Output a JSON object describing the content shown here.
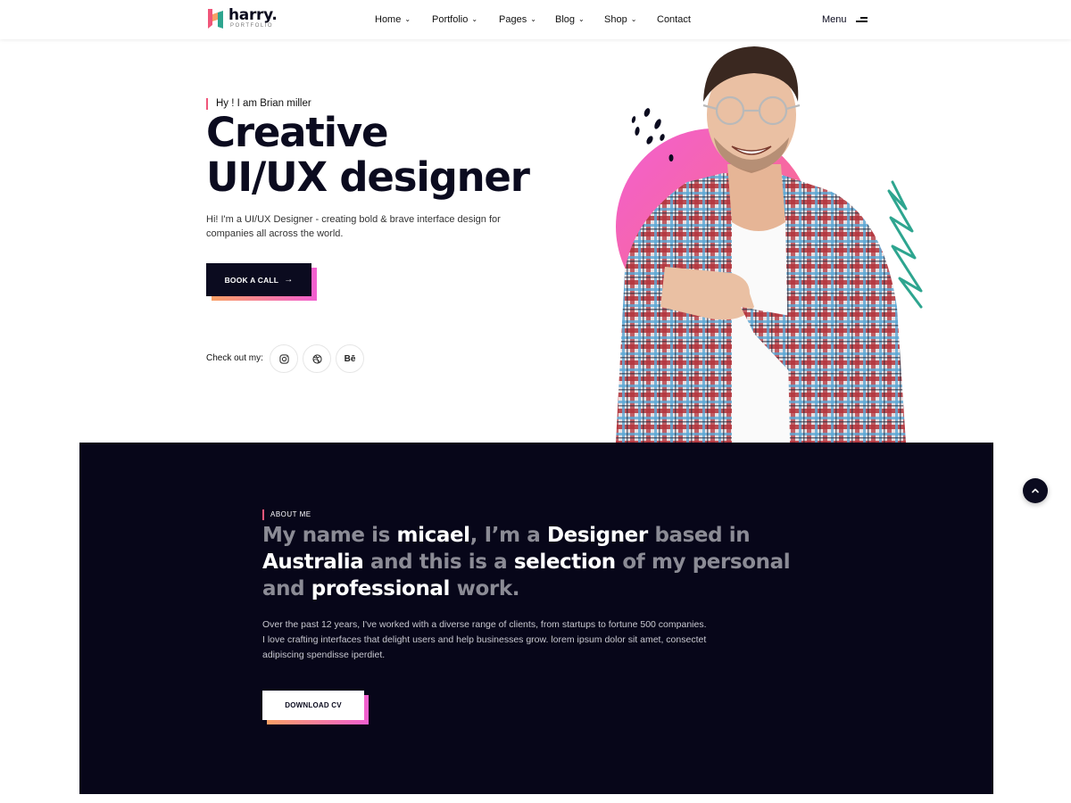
{
  "brand": {
    "name": "harry.",
    "sub": "PORTFOLIO"
  },
  "nav": {
    "items": [
      {
        "label": "Home",
        "dropdown": true
      },
      {
        "label": "Portfolio",
        "dropdown": true
      },
      {
        "label": "Pages",
        "dropdown": true
      },
      {
        "label": "Blog",
        "dropdown": true
      },
      {
        "label": "Shop",
        "dropdown": true
      },
      {
        "label": "Contact",
        "dropdown": false
      }
    ],
    "menu_label": "Menu"
  },
  "hero": {
    "tag": "Hy ! I am Brian miller",
    "title_line1": "Creative",
    "title_line2": "UI/UX designer",
    "description": "Hi! I'm a UI/UX Designer - creating bold & brave interface design for companies all across the world.",
    "cta_label": "BOOK A CALL",
    "social_label": "Check out my:",
    "socials": [
      {
        "icon": "instagram-icon",
        "glyph": "◎"
      },
      {
        "icon": "dribbble-icon",
        "glyph": "⊛"
      },
      {
        "icon": "behance-icon",
        "glyph": "Bē"
      }
    ]
  },
  "about": {
    "tag": "ABOUT ME",
    "title_parts": [
      {
        "text": "My name is ",
        "hl": false
      },
      {
        "text": "micael",
        "hl": true
      },
      {
        "text": ", I’m a ",
        "hl": false
      },
      {
        "text": "Designer",
        "hl": true
      },
      {
        "text": " based in ",
        "hl": false
      },
      {
        "text": "Australia",
        "hl": true
      },
      {
        "text": " and this is a ",
        "hl": false
      },
      {
        "text": "selection",
        "hl": true
      },
      {
        "text": " of my personal and ",
        "hl": false
      },
      {
        "text": "professional",
        "hl": true
      },
      {
        "text": " work.",
        "hl": false
      }
    ],
    "description": "Over the past 12 years, I've worked with a diverse range of clients, from startups to fortune 500 companies. I love crafting interfaces that delight users and help businesses grow. lorem ipsum dolor sit amet, consectet adipiscing spendisse iperdiet.",
    "cta_label": "DOWNLOAD CV"
  },
  "colors": {
    "dark": "#0b0b1f",
    "about_bg": "#070619",
    "accent_pink": "#f25fd0",
    "accent_orange": "#f9a066",
    "accent_red": "#f0567a",
    "accent_teal": "#2ea58f"
  }
}
